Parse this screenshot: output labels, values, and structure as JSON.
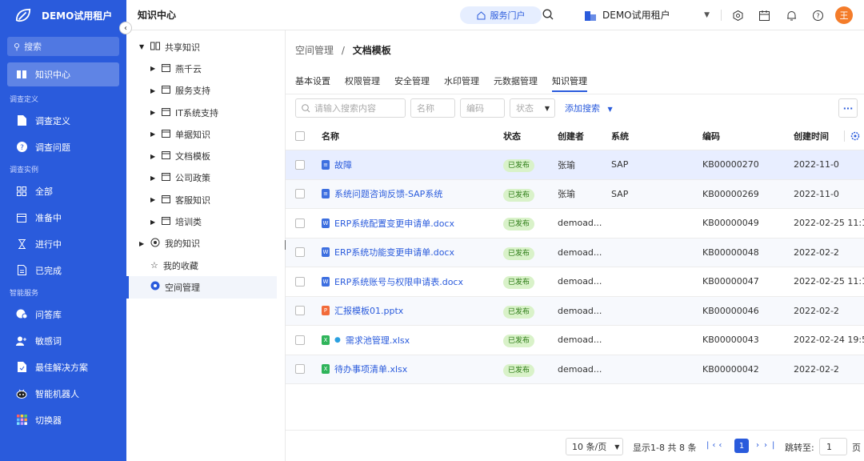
{
  "sidebar": {
    "tenant_name": "DEMO试用租户",
    "search_label": "搜索",
    "active_item": "知识中心",
    "sections": [
      {
        "title": "调查定义",
        "items": [
          "调查定义",
          "调查问题"
        ]
      },
      {
        "title": "调查实例",
        "items": [
          "全部",
          "准备中",
          "进行中",
          "已完成"
        ]
      },
      {
        "title": "智能服务",
        "items": [
          "问答库",
          "敏感词",
          "最佳解决方案",
          "智能机器人",
          "切换器"
        ]
      }
    ]
  },
  "header": {
    "title": "知识中心",
    "portal_label": "服务门户",
    "tenant_label": "DEMO试用租户",
    "avatar_text": "王"
  },
  "tree": {
    "root": "共享知识",
    "children": [
      "燕千云",
      "服务支持",
      "IT系统支持",
      "单据知识",
      "文档模板",
      "公司政策",
      "客服知识",
      "培训类"
    ],
    "my_knowledge": "我的知识",
    "my_favorites": "我的收藏",
    "space_mgmt": "空间管理"
  },
  "breadcrumb": {
    "parent": "空间管理",
    "separator": "/",
    "current": "文档模板"
  },
  "tabs": [
    "基本设置",
    "权限管理",
    "安全管理",
    "水印管理",
    "元数据管理",
    "知识管理"
  ],
  "filters": {
    "search_placeholder": "请输入搜索内容",
    "name_placeholder": "名称",
    "code_placeholder": "编码",
    "status_placeholder": "状态",
    "add_search": "添加搜索",
    "more": "···"
  },
  "table": {
    "columns": [
      "名称",
      "状态",
      "创建者",
      "系统",
      "编码",
      "创建时间"
    ],
    "rows": [
      {
        "icon": "doc",
        "name": "故障",
        "status": "已发布",
        "creator": "张瑜",
        "system": "SAP",
        "code": "KB00000270",
        "time": "2022-11-0"
      },
      {
        "icon": "doc",
        "name": "系统问题咨询反馈-SAP系统",
        "status": "已发布",
        "creator": "张瑜",
        "system": "SAP",
        "code": "KB00000269",
        "time": "2022-11-0"
      },
      {
        "icon": "word",
        "name": "ERP系统配置变更申请单.docx",
        "status": "已发布",
        "creator": "demoad...",
        "system": "",
        "code": "KB00000049",
        "time": "2022-02-25 11:1"
      },
      {
        "icon": "word",
        "name": "ERP系统功能变更申请单.docx",
        "status": "已发布",
        "creator": "demoad...",
        "system": "",
        "code": "KB00000048",
        "time": "2022-02-2"
      },
      {
        "icon": "word",
        "name": "ERP系统账号与权限申请表.docx",
        "status": "已发布",
        "creator": "demoad...",
        "system": "",
        "code": "KB00000047",
        "time": "2022-02-25 11:1"
      },
      {
        "icon": "ppt",
        "name": "汇报模板01.pptx",
        "status": "已发布",
        "creator": "demoad...",
        "system": "",
        "code": "KB00000046",
        "time": "2022-02-2"
      },
      {
        "icon": "excel",
        "name": "需求池管理.xlsx",
        "status": "已发布",
        "creator": "demoad...",
        "system": "",
        "code": "KB00000043",
        "time": "2022-02-24 19:5"
      },
      {
        "icon": "excel",
        "name": "待办事项清单.xlsx",
        "status": "已发布",
        "creator": "demoad...",
        "system": "",
        "code": "KB00000042",
        "time": "2022-02-2"
      }
    ]
  },
  "pagination": {
    "page_size": "10 条/页",
    "summary": "显示1-8 共 8 条",
    "current_page": "1",
    "jump_label": "跳转至:",
    "jump_value": "1",
    "unit": "页"
  },
  "colors": {
    "primary": "#2a5bdc",
    "badge_bg": "#d9f2c9",
    "badge_text": "#2a7a13",
    "word": "#3d6fe0",
    "ppt": "#f26b3a",
    "excel": "#2fb45a",
    "doc": "#3d6fe0"
  }
}
